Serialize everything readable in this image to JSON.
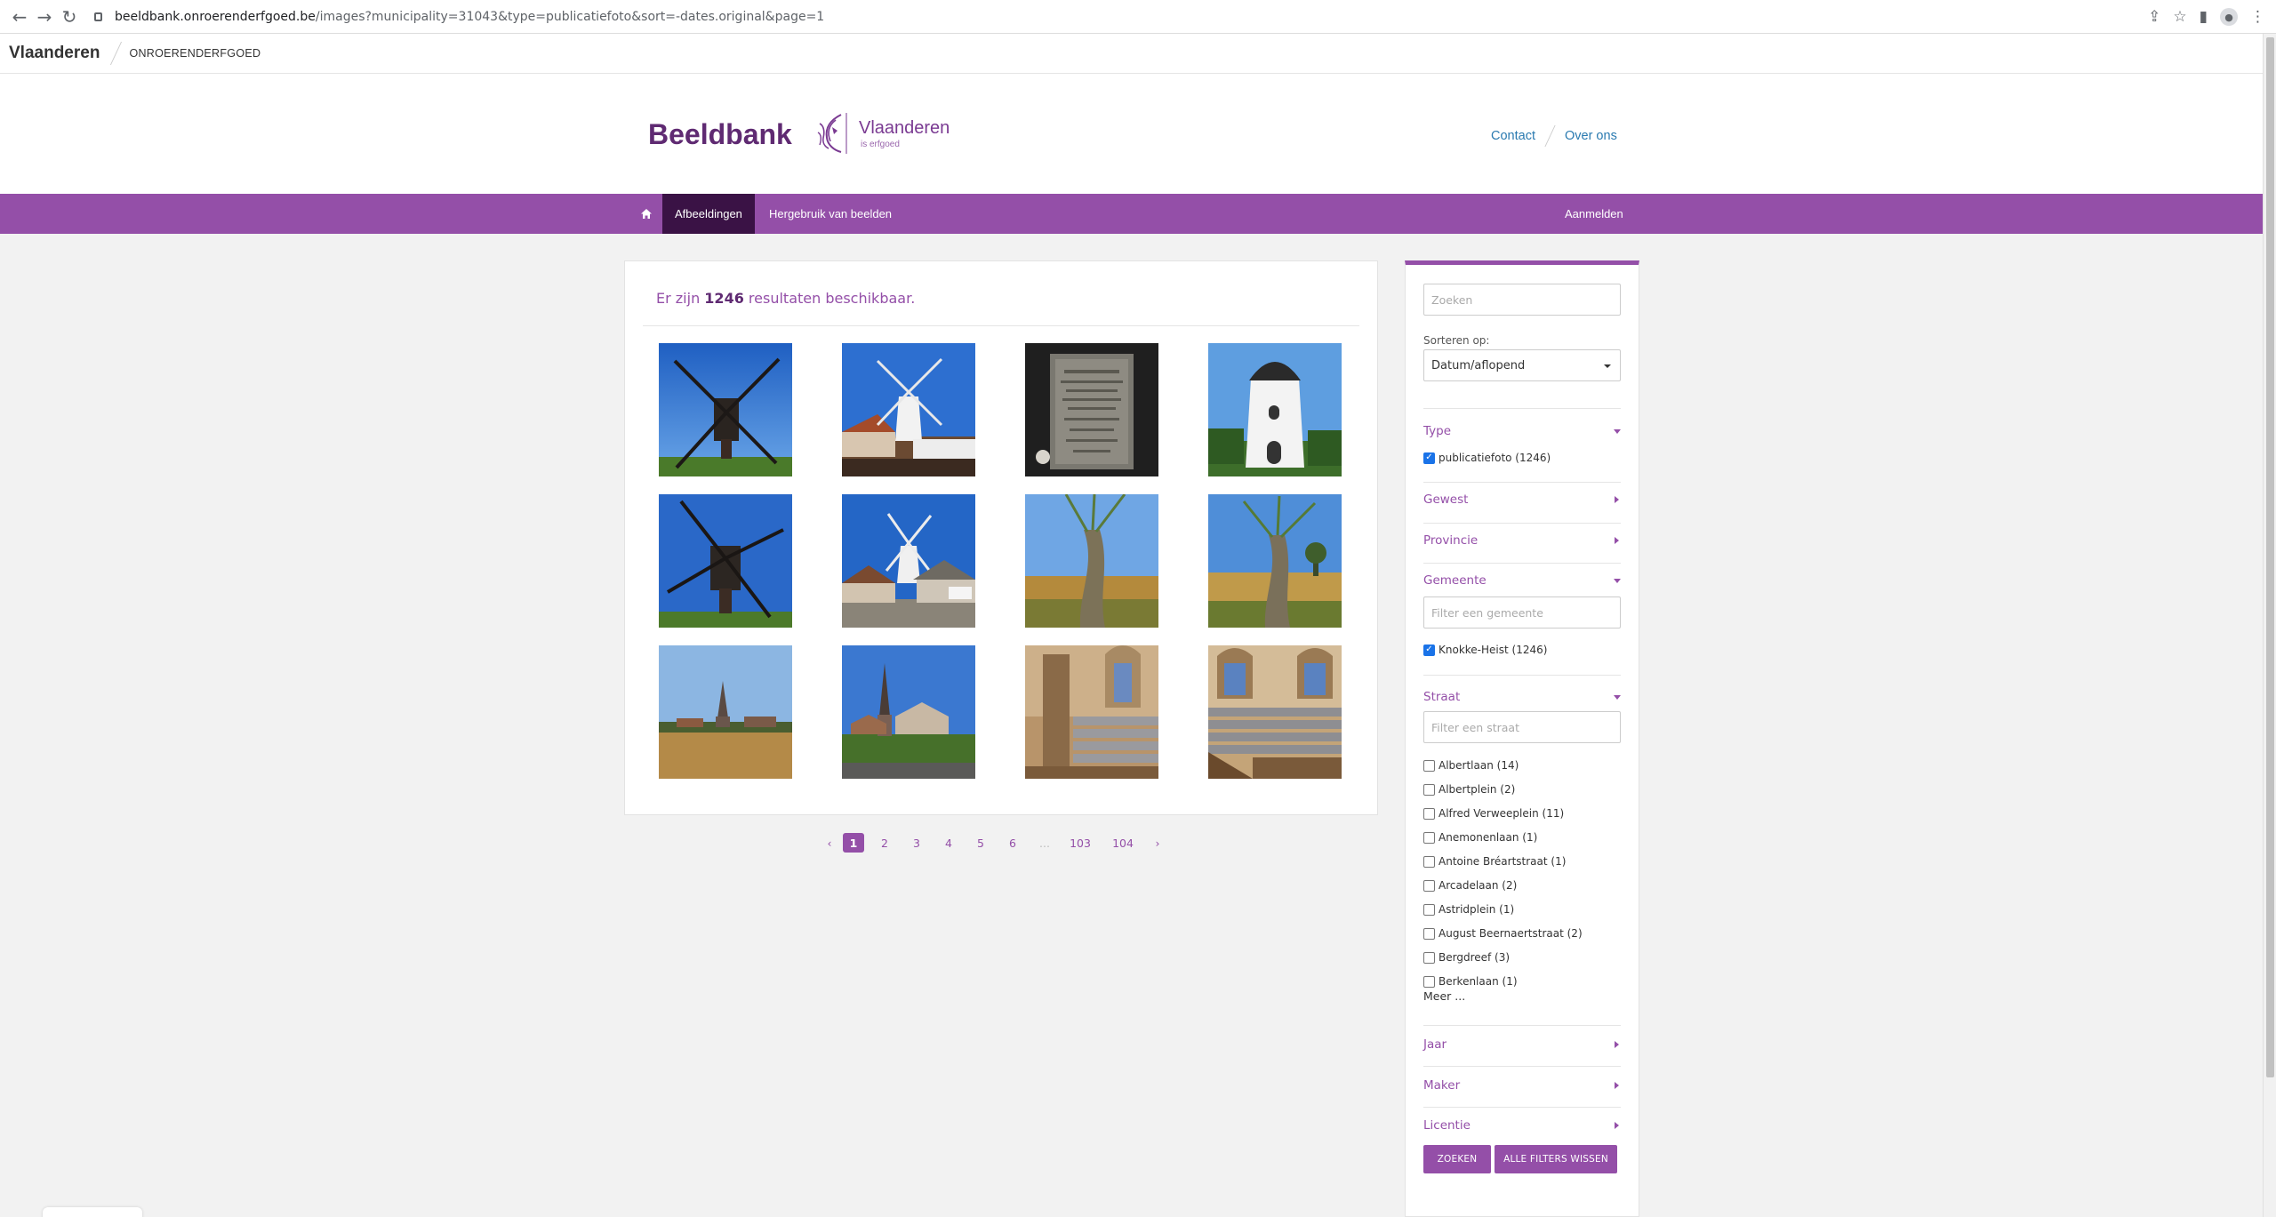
{
  "browser": {
    "url_domain": "beeldbank.onroerenderfgoed.be",
    "url_path": "/images?municipality=31043&type=publicatiefoto&sort=-dates.original&page=1"
  },
  "topbar": {
    "brand": "Vlaanderen",
    "agency": "ONROERENDERFGOED"
  },
  "header": {
    "title": "Beeldbank",
    "logo_name": "Vlaanderen",
    "logo_tagline": "is erfgoed",
    "links": [
      "Contact",
      "Over ons"
    ]
  },
  "nav": {
    "items": [
      "Afbeeldingen",
      "Hergebruik van beelden"
    ],
    "login": "Aanmelden",
    "active_color": "#3a1245",
    "bar_color": "#944fa8"
  },
  "results": {
    "prefix": "Er zijn",
    "count": "1246",
    "suffix": "resultaten beschikbaar.",
    "thumbnails": [
      "windmill-post-mill-blue-sky",
      "white-windmill-with-terrace",
      "memorial-plaque",
      "white-tower-windmill",
      "post-mill-blue-sky",
      "white-windmill-behind-houses",
      "pollard-willow-in-field",
      "pollard-willow-field-wide",
      "village-church-across-field",
      "church-spire-behind-hedge",
      "church-interior-seating",
      "church-interior-tiered-seats"
    ]
  },
  "pagination": {
    "prev": "‹",
    "pages": [
      "1",
      "2",
      "3",
      "4",
      "5",
      "6",
      "...",
      "103",
      "104"
    ],
    "next": "›",
    "current": "1"
  },
  "sidebar": {
    "search_placeholder": "Zoeken",
    "sort_label": "Sorteren op:",
    "sort_value": "Datum/aflopend",
    "facets": {
      "type": "Type",
      "type_option": "publicatiefoto (1246)",
      "gewest": "Gewest",
      "provincie": "Provincie",
      "gemeente": "Gemeente",
      "gemeente_placeholder": "Filter een gemeente",
      "gemeente_option": "Knokke-Heist (1246)",
      "straat": "Straat",
      "straat_placeholder": "Filter een straat",
      "straten": [
        "Albertlaan (14)",
        "Albertplein (2)",
        "Alfred Verweeplein (11)",
        "Anemonenlaan (1)",
        "Antoine Bréartstraat (1)",
        "Arcadelaan (2)",
        "Astridplein (1)",
        "August Beernaertstraat (2)",
        "Bergdreef (3)",
        "Berkenlaan (1)"
      ],
      "meer": "Meer ...",
      "jaar": "Jaar",
      "maker": "Maker",
      "licentie": "Licentie"
    },
    "search_button": "ZOEKEN",
    "clear_button": "ALLE FILTERS WISSEN"
  }
}
